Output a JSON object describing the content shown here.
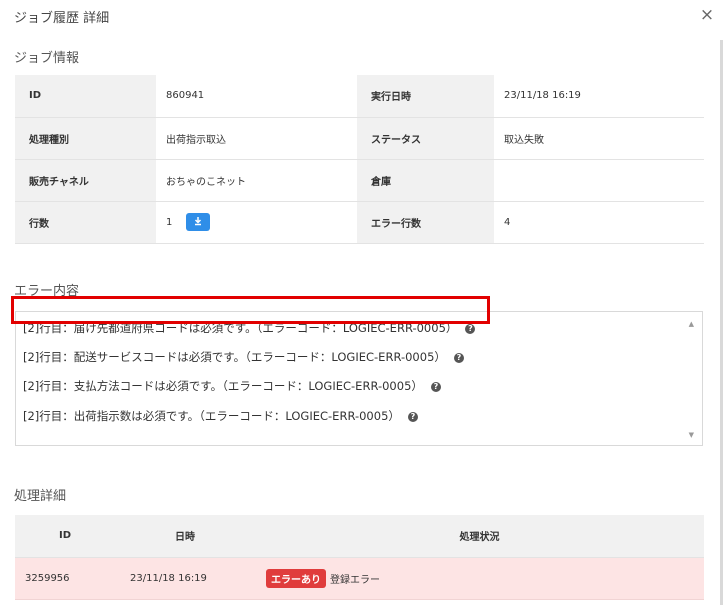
{
  "modal": {
    "title": "ジョブ履歴 詳細",
    "close_icon": "×"
  },
  "job_info": {
    "section_title": "ジョブ情報",
    "rows": [
      {
        "k1": "ID",
        "v1": "860941",
        "k2": "実行日時",
        "v2": "23/11/18 16:19"
      },
      {
        "k1": "処理種別",
        "v1": "出荷指示取込",
        "k2": "ステータス",
        "v2": "取込失敗"
      },
      {
        "k1": "販売チャネル",
        "v1": "おちゃのこネット",
        "k2": "倉庫",
        "v2": ""
      },
      {
        "k1": "行数",
        "v1": "1",
        "k2": "エラー行数",
        "v2": "4"
      }
    ],
    "download_icon": "download-icon"
  },
  "errors": {
    "section_title": "エラー内容",
    "lines": [
      "[2]行目：届け先都道府県コードは必須です。（エラーコード：LOGIEC-ERR-0005）",
      "[2]行目：配送サービスコードは必須です。（エラーコード：LOGIEC-ERR-0005）",
      "[2]行目：支払方法コードは必須です。（エラーコード：LOGIEC-ERR-0005）",
      "[2]行目：出荷指示数は必須です。（エラーコード：LOGIEC-ERR-0005）"
    ],
    "help_icon": "?"
  },
  "process": {
    "section_title": "処理詳細",
    "headers": [
      "ID",
      "日時",
      "処理状況"
    ],
    "rows": [
      {
        "id": "3259956",
        "datetime": "23/11/18 16:19",
        "badge": "エラーあり",
        "status": "登録エラー"
      }
    ]
  },
  "colors": {
    "highlight": "#e20000",
    "error_row_bg": "#fde4e4",
    "badge_bg": "#e03c3c",
    "download_btn": "#2f8ee8"
  }
}
